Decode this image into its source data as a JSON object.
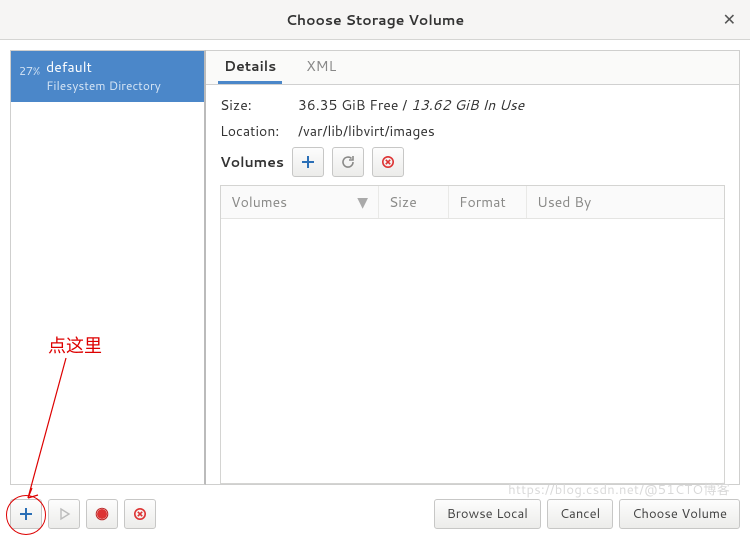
{
  "window": {
    "title": "Choose Storage Volume"
  },
  "sidebar": {
    "pool": {
      "percent": "27%",
      "name": "default",
      "subtitle": "Filesystem Directory"
    }
  },
  "tabs": {
    "details": "Details",
    "xml": "XML"
  },
  "details": {
    "size_label": "Size:",
    "size_free": "36.35 GiB Free",
    "size_sep": " / ",
    "size_inuse": "13.62 GiB In Use",
    "location_label": "Location:",
    "location_value": "/var/lib/libvirt/images",
    "volumes_label": "Volumes"
  },
  "columns": {
    "volumes": "Volumes",
    "size": "Size",
    "format": "Format",
    "usedby": "Used By"
  },
  "footer": {
    "browse_local": "Browse Local",
    "cancel": "Cancel",
    "choose_volume": "Choose Volume"
  },
  "annotation": {
    "text": "点这里"
  },
  "watermark": "https://blog.csdn.net/@51CTO博客"
}
